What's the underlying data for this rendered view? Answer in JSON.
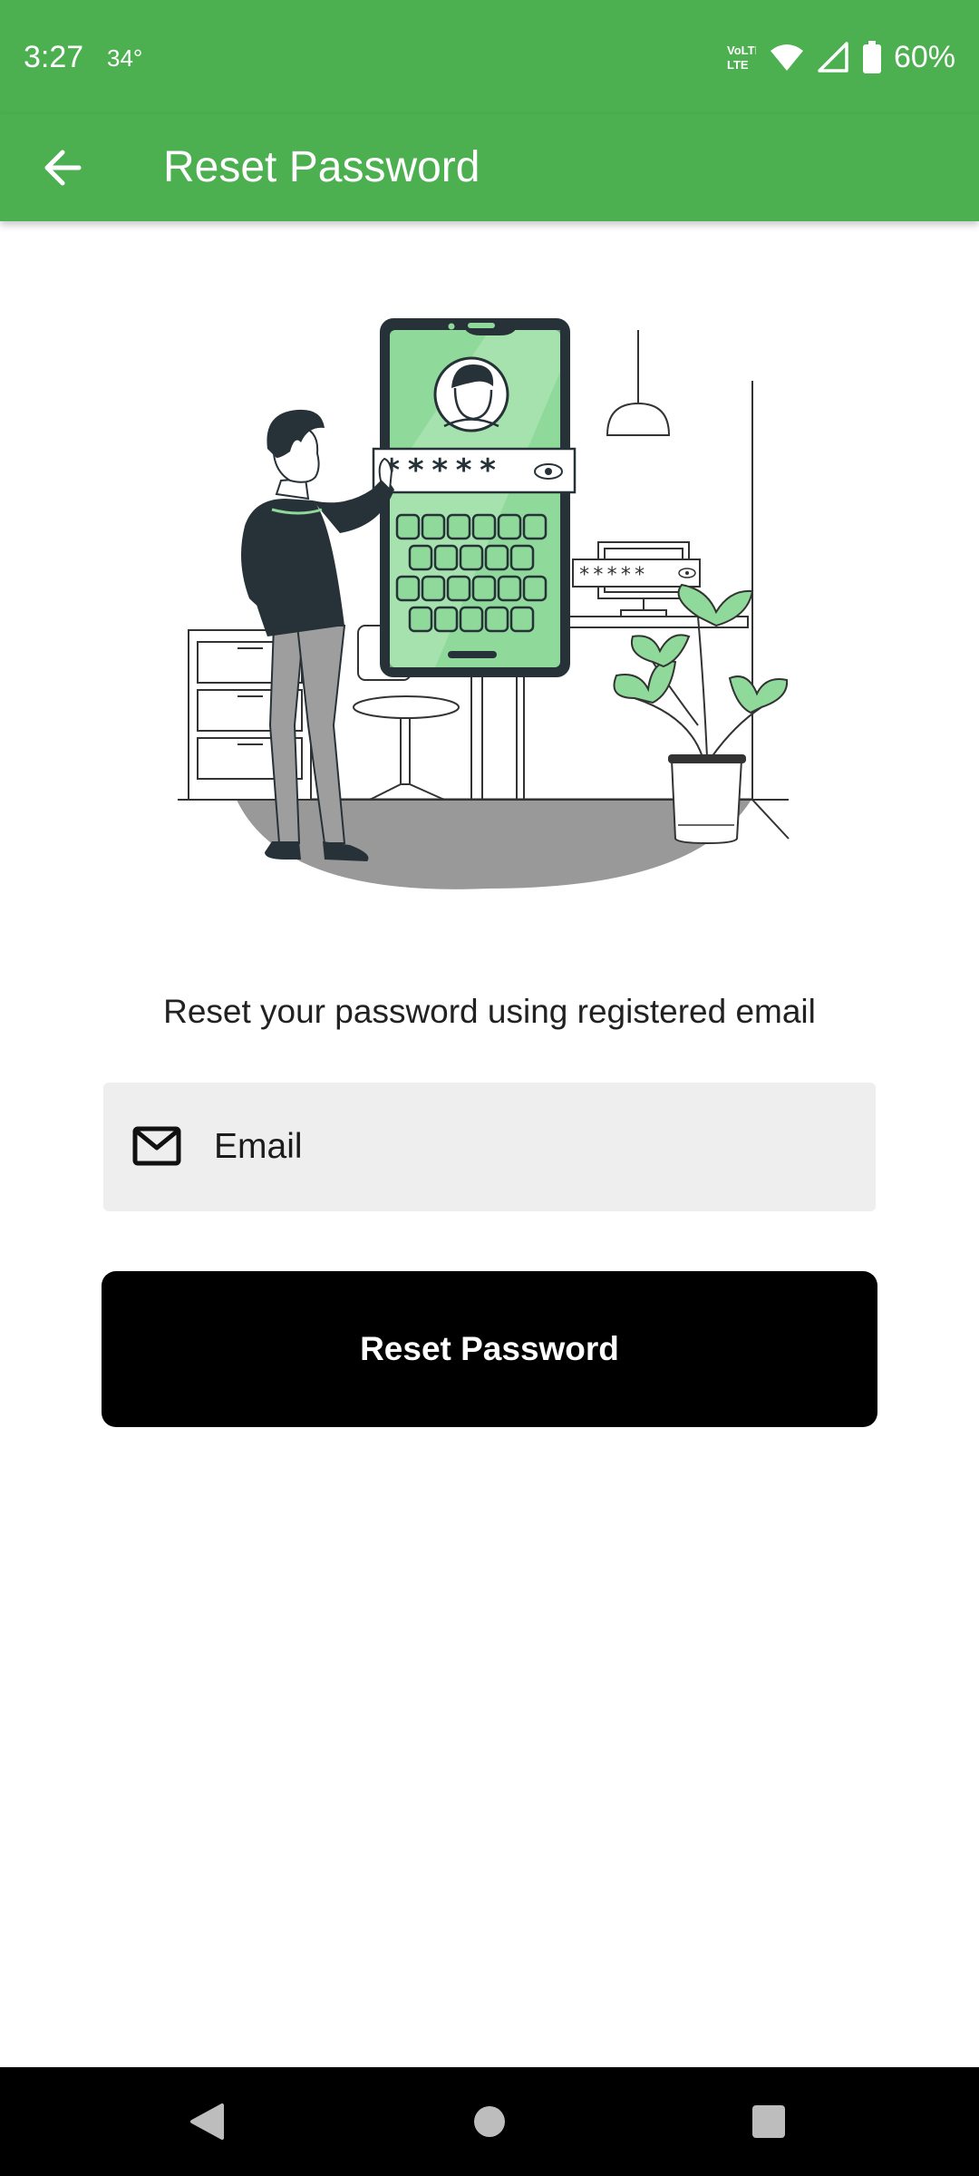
{
  "status_bar": {
    "time": "3:27",
    "temperature": "34°",
    "battery": "60%",
    "icons": [
      "volte-icon",
      "wifi-icon",
      "cellular-signal-icon",
      "battery-icon"
    ]
  },
  "app_bar": {
    "title": "Reset Password",
    "back_icon": "arrow-back-icon"
  },
  "illustration": {
    "password_mask": "*****",
    "monitor_mask": "*****"
  },
  "content": {
    "instruction": "Reset your password using registered email",
    "email_field": {
      "placeholder": "Email",
      "value": "",
      "icon": "mail-icon"
    },
    "reset_button_label": "Reset Password"
  },
  "nav_bar": {
    "icons": [
      "back-triangle-icon",
      "home-circle-icon",
      "recents-square-icon"
    ]
  },
  "colors": {
    "primary": "#4caf50",
    "button": "#000000",
    "field_background": "#eeeeee",
    "illustration_accent": "#8fd99a"
  }
}
